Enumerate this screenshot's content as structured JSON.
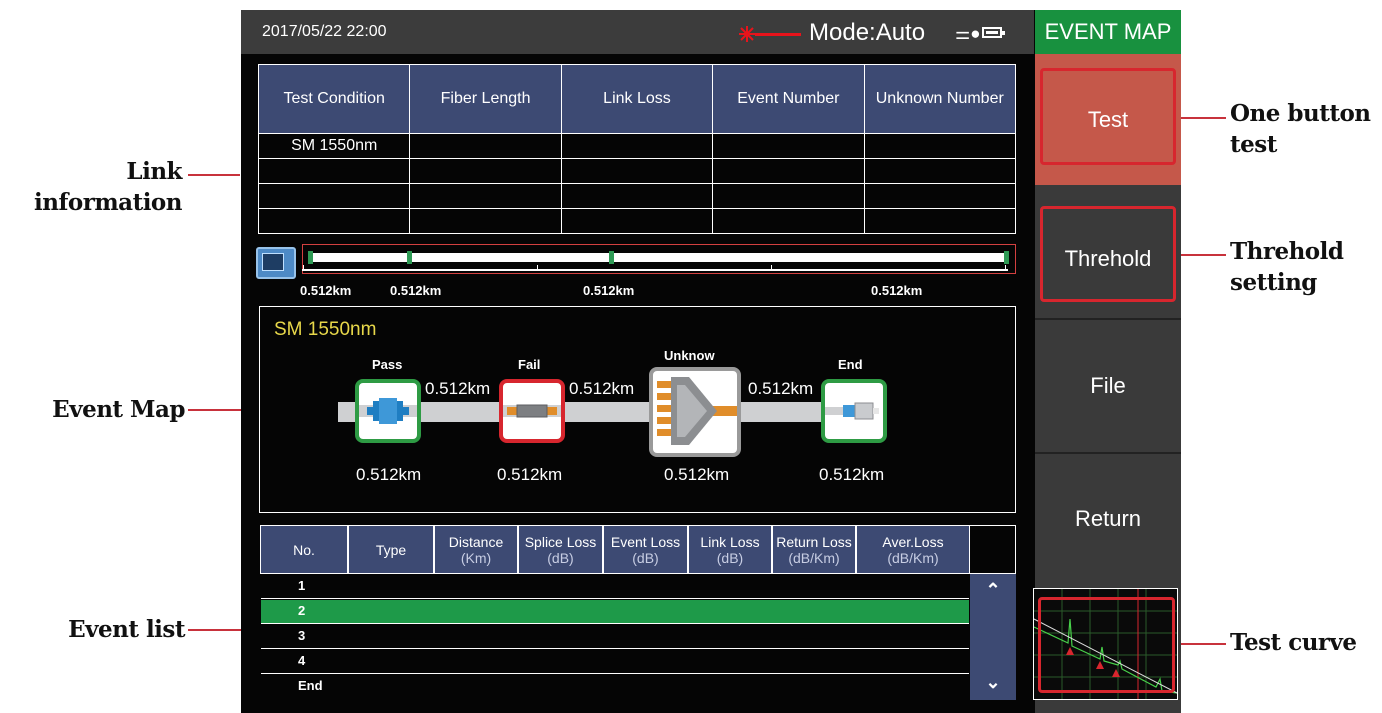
{
  "annotations": {
    "link_info": "Link\ninformation",
    "event_map": "Event Map",
    "event_list": "Event list",
    "one_button_test": "One button\ntest",
    "threhold_setting": "Threhold\nsetting",
    "test_curve": "Test curve"
  },
  "status_bar": {
    "datetime": "2017/05/22  22:00",
    "mode": "Mode:Auto",
    "laser_icon": "laser-burst-icon",
    "power_icon": "plug-icon",
    "battery_icon": "battery-icon"
  },
  "link_table": {
    "headers": [
      "Test Condition",
      "Fiber Length",
      "Link Loss",
      "Event Number",
      "Unknown Number"
    ],
    "rows": [
      [
        "SM 1550nm",
        "",
        "",
        "",
        ""
      ],
      [
        "",
        "",
        "",
        "",
        ""
      ],
      [
        "",
        "",
        "",
        "",
        ""
      ],
      [
        "",
        "",
        "",
        "",
        ""
      ]
    ]
  },
  "fiber_bar": {
    "labels": [
      "0.512km",
      "0.512km",
      "0.512km",
      "0.512km"
    ]
  },
  "event_map": {
    "wavelength": "SM 1550nm",
    "events": [
      {
        "status": "Pass",
        "distance": "0.512km",
        "icon": "connector-icon",
        "color": "#2e9b44"
      },
      {
        "status": "Fail",
        "distance": "0.512km",
        "icon": "splice-icon",
        "color": "#d7262e"
      },
      {
        "status": "Unknow",
        "distance": "0.512km",
        "icon": "splitter-icon",
        "color": "#9a9a9a"
      },
      {
        "status": "End",
        "distance": "0.512km",
        "icon": "fiber-end-icon",
        "color": "#2e9b44"
      }
    ],
    "segments": [
      "0.512km",
      "0.512km",
      "0.512km"
    ]
  },
  "event_list": {
    "columns": [
      {
        "label": "No.",
        "unit": ""
      },
      {
        "label": "Type",
        "unit": ""
      },
      {
        "label": "Distance",
        "unit": "(Km)"
      },
      {
        "label": "Splice Loss",
        "unit": "(dB)"
      },
      {
        "label": "Event Loss",
        "unit": "(dB)"
      },
      {
        "label": "Link Loss",
        "unit": "(dB)"
      },
      {
        "label": "Return Loss",
        "unit": "(dB/Km)"
      },
      {
        "label": "Aver.Loss",
        "unit": "(dB/Km)"
      }
    ],
    "rows": [
      "1",
      "2",
      "3",
      "4",
      "End"
    ],
    "selected_row": "2",
    "scroll_up_icon": "chevron-up-icon",
    "scroll_down_icon": "chevron-down-icon"
  },
  "side_panel": {
    "title": "EVENT MAP",
    "buttons": [
      "Test",
      "Threhold",
      "File",
      "Return"
    ],
    "title_color": "#18913f",
    "test_color": "#c5584a"
  }
}
